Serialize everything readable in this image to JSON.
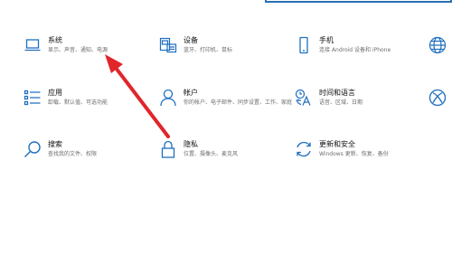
{
  "tiles": {
    "system": {
      "title": "系统",
      "desc": "显示、声音、通知、电源",
      "icon": "laptop-icon"
    },
    "devices": {
      "title": "设备",
      "desc": "蓝牙、打印机、鼠标",
      "icon": "keyboard-printer-icon"
    },
    "phone": {
      "title": "手机",
      "desc": "连接 Android 设备和 iPhone",
      "icon": "phone-icon"
    },
    "network": {
      "icon": "globe-icon"
    },
    "apps": {
      "title": "应用",
      "desc": "卸载、默认值、可选功能",
      "icon": "apps-list-icon"
    },
    "accounts": {
      "title": "帐户",
      "desc": "你的帐户、电子邮件、同步设置、工作、家庭",
      "icon": "person-icon"
    },
    "time": {
      "title": "时间和语言",
      "desc": "语音、区域、日期",
      "icon": "time-language-icon"
    },
    "gaming": {
      "icon": "xbox-icon"
    },
    "search": {
      "title": "搜索",
      "desc": "查找我的文件、权限",
      "icon": "magnifier-icon"
    },
    "privacy": {
      "title": "隐私",
      "desc": "位置、摄像头、麦克风",
      "icon": "lock-icon"
    },
    "update": {
      "title": "更新和安全",
      "desc": "Windows 更新、恢复、备份",
      "icon": "sync-icon"
    }
  },
  "colors": {
    "accent": "#1f6fbf",
    "arrow": "#e0262b"
  }
}
